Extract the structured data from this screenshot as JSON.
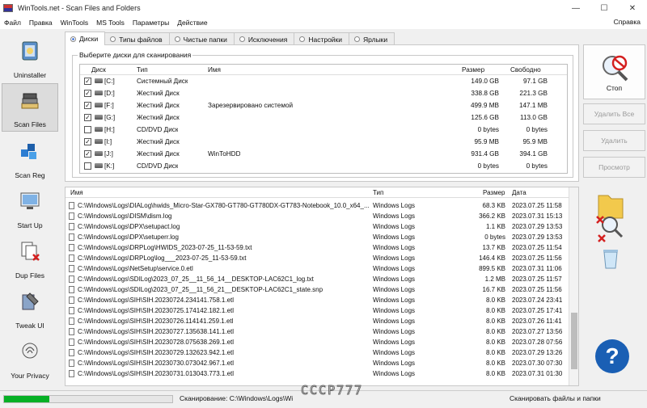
{
  "window": {
    "title": "WinTools.net - Scan Files and Folders",
    "controls": [
      "—",
      "☐",
      "✕"
    ]
  },
  "menu": {
    "items": [
      "Файл",
      "Правка",
      "WinTools",
      "MS Tools",
      "Параметры",
      "Действие"
    ],
    "help": "Справка"
  },
  "sidebar": {
    "items": [
      {
        "label": "Uninstaller",
        "icon": "uninstaller-icon"
      },
      {
        "label": "Scan Files",
        "icon": "scan-files-icon"
      },
      {
        "label": "Scan Reg",
        "icon": "scan-reg-icon"
      },
      {
        "label": "Start Up",
        "icon": "startup-icon"
      },
      {
        "label": "Dup Files",
        "icon": "dup-files-icon"
      },
      {
        "label": "Tweak UI",
        "icon": "tweak-ui-icon"
      },
      {
        "label": "Your Privacy",
        "icon": "privacy-icon"
      }
    ]
  },
  "tabs": [
    "Диски",
    "Типы файлов",
    "Чистые папки",
    "Исключения",
    "Настройки",
    "Ярлыки"
  ],
  "disks": {
    "group_label": "Выберите диски для сканирования",
    "columns": [
      "Диск",
      "Тип",
      "Имя",
      "Размер",
      "Свободно"
    ],
    "rows": [
      {
        "drive": "[C:]",
        "type": "Системный Диск",
        "name": "",
        "size": "149.0 GB",
        "free": "97.1 GB",
        "checked": true
      },
      {
        "drive": "[D:]",
        "type": "Жесткий Диск",
        "name": "",
        "size": "338.8 GB",
        "free": "221.3 GB",
        "checked": true
      },
      {
        "drive": "[F:]",
        "type": "Жесткий Диск",
        "name": "Зарезервировано системой",
        "size": "499.9 MB",
        "free": "147.1 MB",
        "checked": true
      },
      {
        "drive": "[G:]",
        "type": "Жесткий Диск",
        "name": "",
        "size": "125.6 GB",
        "free": "113.0 GB",
        "checked": true
      },
      {
        "drive": "[H:]",
        "type": "CD/DVD Диск",
        "name": "",
        "size": "0 bytes",
        "free": "0 bytes",
        "checked": false
      },
      {
        "drive": "[I:]",
        "type": "Жесткий Диск",
        "name": "",
        "size": "95.9 MB",
        "free": "95.9 MB",
        "checked": true
      },
      {
        "drive": "[J:]",
        "type": "Жесткий Диск",
        "name": "WinToHDD",
        "size": "931.4 GB",
        "free": "394.1 GB",
        "checked": true
      },
      {
        "drive": "[K:]",
        "type": "CD/DVD Диск",
        "name": "",
        "size": "0 bytes",
        "free": "0 bytes",
        "checked": false
      }
    ]
  },
  "actions": {
    "stop": "Стоп",
    "delete_all": "Удалить Все",
    "delete": "Удалить",
    "view": "Просмотр"
  },
  "files": {
    "columns": [
      "Имя",
      "Тип",
      "Размер",
      "Дата"
    ],
    "rows": [
      {
        "name": "C:\\Windows\\Logs\\DIALog\\hwids_Micro-Star-GX780-GT780-GT780DX-GT783-Notebook_10.0_x64_...",
        "type": "Windows Logs",
        "size": "68.3 KB",
        "date": "2023.07.25 11:58"
      },
      {
        "name": "C:\\Windows\\Logs\\DISM\\dism.log",
        "type": "Windows Logs",
        "size": "366.2 KB",
        "date": "2023.07.31 15:13"
      },
      {
        "name": "C:\\Windows\\Logs\\DPX\\setupact.log",
        "type": "Windows Logs",
        "size": "1.1 KB",
        "date": "2023.07.29 13:53"
      },
      {
        "name": "C:\\Windows\\Logs\\DPX\\setuperr.log",
        "type": "Windows Logs",
        "size": "0 bytes",
        "date": "2023.07.29 13:53"
      },
      {
        "name": "C:\\Windows\\Logs\\DRPLog\\HWIDS_2023-07-25_11-53-59.txt",
        "type": "Windows Logs",
        "size": "13.7 KB",
        "date": "2023.07.25 11:54"
      },
      {
        "name": "C:\\Windows\\Logs\\DRPLog\\log___2023-07-25_11-53-59.txt",
        "type": "Windows Logs",
        "size": "146.4 KB",
        "date": "2023.07.25 11:56"
      },
      {
        "name": "C:\\Windows\\Logs\\NetSetup\\service.0.etl",
        "type": "Windows Logs",
        "size": "899.5 KB",
        "date": "2023.07.31 11:06"
      },
      {
        "name": "C:\\Windows\\Logs\\SDILog\\2023_07_25__11_56_14__DESKTOP-LAC62C1_log.txt",
        "type": "Windows Logs",
        "size": "1.2 MB",
        "date": "2023.07.25 11:57"
      },
      {
        "name": "C:\\Windows\\Logs\\SDILog\\2023_07_25__11_56_21__DESKTOP-LAC62C1_state.snp",
        "type": "Windows Logs",
        "size": "16.7 KB",
        "date": "2023.07.25 11:56"
      },
      {
        "name": "C:\\Windows\\Logs\\SIH\\SIH.20230724.234141.758.1.etl",
        "type": "Windows Logs",
        "size": "8.0 KB",
        "date": "2023.07.24 23:41"
      },
      {
        "name": "C:\\Windows\\Logs\\SIH\\SIH.20230725.174142.182.1.etl",
        "type": "Windows Logs",
        "size": "8.0 KB",
        "date": "2023.07.25 17:41"
      },
      {
        "name": "C:\\Windows\\Logs\\SIH\\SIH.20230726.114141.259.1.etl",
        "type": "Windows Logs",
        "size": "8.0 KB",
        "date": "2023.07.26 11:41"
      },
      {
        "name": "C:\\Windows\\Logs\\SIH\\SIH.20230727.135638.141.1.etl",
        "type": "Windows Logs",
        "size": "8.0 KB",
        "date": "2023.07.27 13:56"
      },
      {
        "name": "C:\\Windows\\Logs\\SIH\\SIH.20230728.075638.269.1.etl",
        "type": "Windows Logs",
        "size": "8.0 KB",
        "date": "2023.07.28 07:56"
      },
      {
        "name": "C:\\Windows\\Logs\\SIH\\SIH.20230729.132623.942.1.etl",
        "type": "Windows Logs",
        "size": "8.0 KB",
        "date": "2023.07.29 13:26"
      },
      {
        "name": "C:\\Windows\\Logs\\SIH\\SIH.20230730.073042.967.1.etl",
        "type": "Windows Logs",
        "size": "8.0 KB",
        "date": "2023.07.30 07:30"
      },
      {
        "name": "C:\\Windows\\Logs\\SIH\\SIH.20230731.013043.773.1.etl",
        "type": "Windows Logs",
        "size": "8.0 KB",
        "date": "2023.07.31 01:30"
      }
    ]
  },
  "status": {
    "progress_percent": 27,
    "scanning": "Сканирование: C:\\Windows\\Logs\\Wi",
    "right": "Сканировать файлы и папки",
    "watermark": "СССР777"
  },
  "colors": {
    "accent": "#1a5fb4",
    "progress": "#06b025",
    "stop_red": "#d42020"
  }
}
